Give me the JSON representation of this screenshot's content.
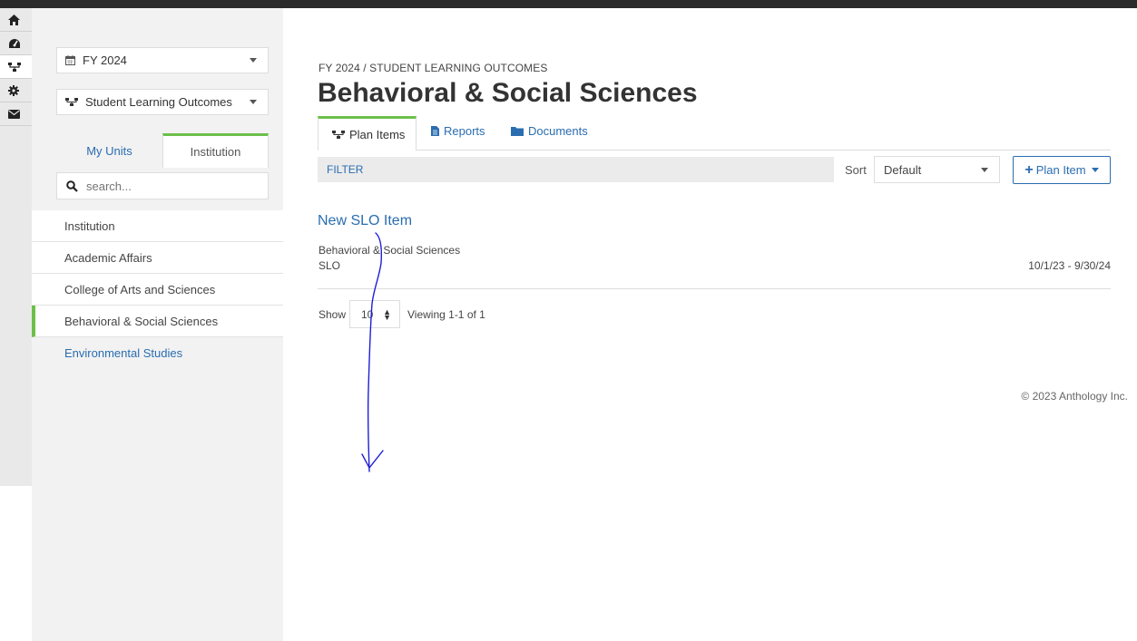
{
  "sidebar": {
    "fiscal_year": "FY 2024",
    "plan_type": "Student Learning Outcomes",
    "unit_tabs": {
      "my_units": "My Units",
      "institution": "Institution"
    },
    "search_placeholder": "search...",
    "units": [
      {
        "label": "Institution"
      },
      {
        "label": "Academic Affairs"
      },
      {
        "label": "College of Arts and Sciences"
      },
      {
        "label": "Behavioral & Social Sciences"
      },
      {
        "label": "Environmental Studies"
      }
    ]
  },
  "header": {
    "breadcrumb": "FY 2024 / STUDENT LEARNING OUTCOMES",
    "title": "Behavioral & Social Sciences"
  },
  "tabs": {
    "plan_items": "Plan Items",
    "reports": "Reports",
    "documents": "Documents"
  },
  "toolbar": {
    "filter": "FILTER",
    "sort_label": "Sort",
    "sort_value": "Default",
    "add_label": "Plan Item"
  },
  "items": [
    {
      "title": "New SLO Item",
      "unit": "Behavioral & Social Sciences",
      "type": "SLO",
      "dates": "10/1/23 - 9/30/24"
    }
  ],
  "pagination": {
    "show_label": "Show",
    "page_size": "10",
    "viewing": "Viewing 1-1 of 1"
  },
  "footer": "© 2023 Anthology Inc.",
  "colors": {
    "accent_green": "#6cc04a",
    "link_blue": "#2a6db0",
    "annotation_ink": "#1f1fd6"
  }
}
